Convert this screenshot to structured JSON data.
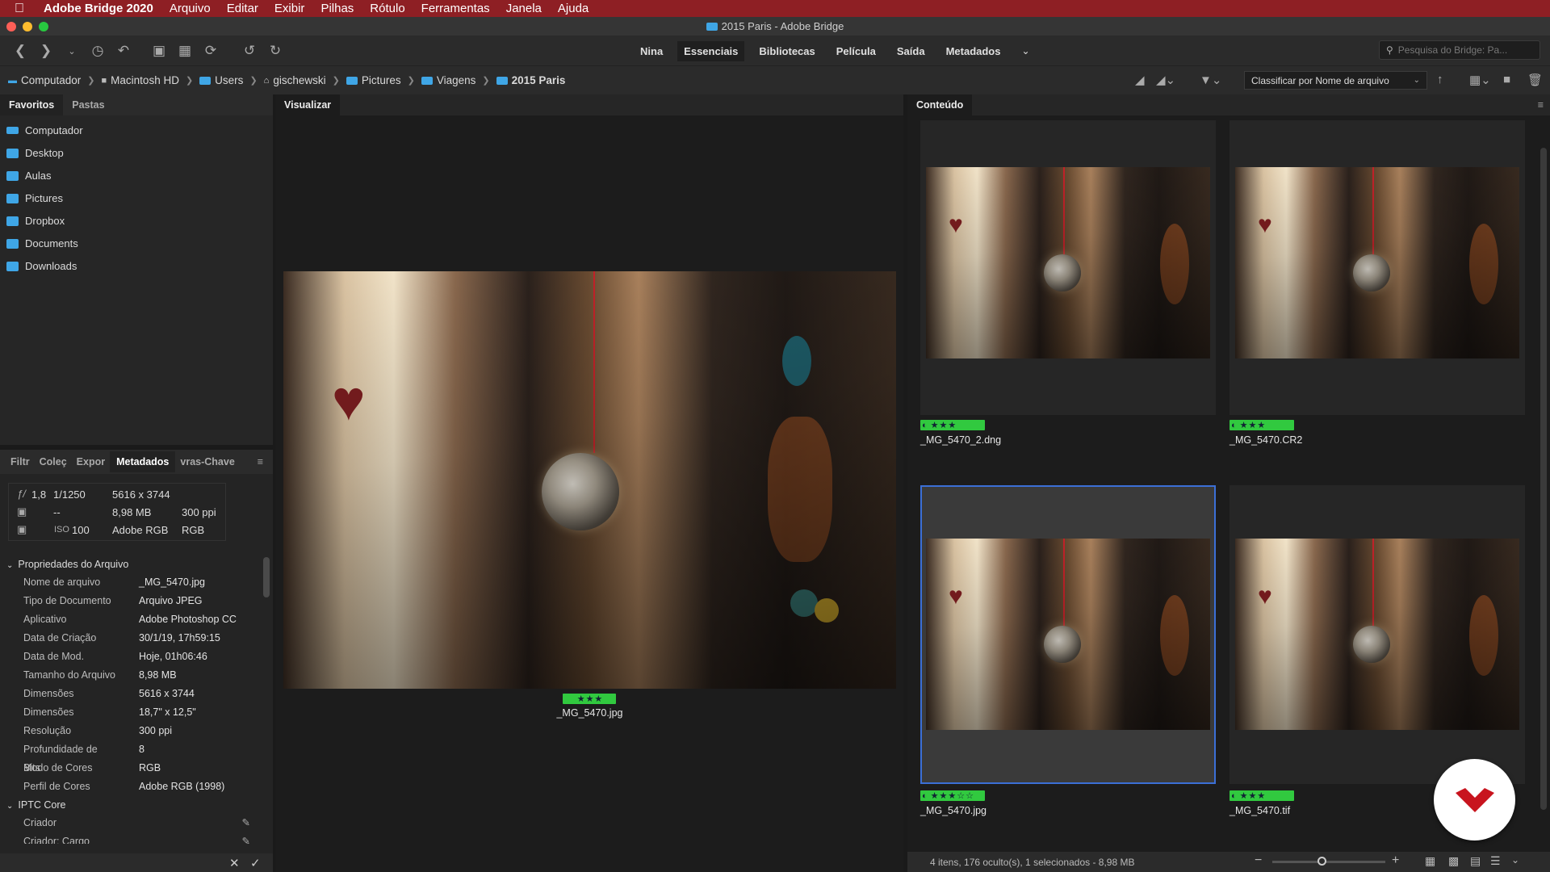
{
  "menubar": {
    "app_name": "Adobe Bridge 2020",
    "items": [
      "Arquivo",
      "Editar",
      "Exibir",
      "Pilhas",
      "Rótulo",
      "Ferramentas",
      "Janela",
      "Ajuda"
    ]
  },
  "window": {
    "title": "2015 Paris - Adobe Bridge"
  },
  "workspaces": [
    "Nina",
    "Essenciais",
    "Bibliotecas",
    "Película",
    "Saída",
    "Metadados"
  ],
  "active_workspace": "Essenciais",
  "search": {
    "placeholder": "Pesquisa do Bridge: Pa..."
  },
  "path": [
    "Computador",
    "Macintosh HD",
    "Users",
    "gischewski",
    "Pictures",
    "Viagens",
    "2015 Paris"
  ],
  "sort": {
    "label": "Classificar por Nome de arquivo"
  },
  "left_top": {
    "tabs": [
      "Favoritos",
      "Pastas"
    ],
    "favorites": [
      "Computador",
      "Desktop",
      "Aulas",
      "Pictures",
      "Dropbox",
      "Documents",
      "Downloads"
    ]
  },
  "left_bottom": {
    "tabs": [
      "Filtr",
      "Coleç",
      "Expor",
      "Metadados",
      "vras-Chave"
    ],
    "exif": {
      "aperture": "1,8",
      "shutter": "1/1250",
      "dimensions": "5616 x 3744",
      "metering": "--",
      "size": "8,98 MB",
      "resolution": "300 ppi",
      "iso_label": "ISO",
      "iso": "100",
      "profile": "Adobe RGB",
      "mode": "RGB"
    },
    "file_props_header": "Propriedades do Arquivo",
    "file_props": [
      {
        "k": "Nome de arquivo",
        "v": "_MG_5470.jpg"
      },
      {
        "k": "Tipo de Documento",
        "v": "Arquivo JPEG"
      },
      {
        "k": "Aplicativo",
        "v": "Adobe Photoshop CC"
      },
      {
        "k": "Data de Criação",
        "v": "30/1/19, 17h59:15"
      },
      {
        "k": "Data de Mod.",
        "v": "Hoje, 01h06:46"
      },
      {
        "k": "Tamanho do Arquivo",
        "v": "8,98 MB"
      },
      {
        "k": "Dimensões",
        "v": "5616 x 3744"
      },
      {
        "k": "Dimensões",
        "v": "18,7\" x 12,5\""
      },
      {
        "k": "Resolução",
        "v": "300 ppi"
      },
      {
        "k": "Profundidade de Bits",
        "v": "8"
      },
      {
        "k": "Modo de Cores",
        "v": "RGB"
      },
      {
        "k": "Perfil de Cores",
        "v": "Adobe RGB (1998)"
      }
    ],
    "iptc_header": "IPTC Core",
    "iptc": [
      "Criador",
      "Criador: Cargo"
    ]
  },
  "preview": {
    "tab": "Visualizar",
    "file": "_MG_5470.jpg",
    "rating": 3
  },
  "content": {
    "tab": "Conteúdo",
    "items": [
      {
        "name": "_MG_5470_2.dng",
        "rating": 3,
        "max": 3,
        "selected": false
      },
      {
        "name": "_MG_5470.CR2",
        "rating": 3,
        "max": 3,
        "selected": false
      },
      {
        "name": "_MG_5470.jpg",
        "rating": 3,
        "max": 5,
        "selected": true
      },
      {
        "name": "_MG_5470.tif",
        "rating": 3,
        "max": 3,
        "selected": false
      }
    ],
    "status": "4 itens, 176 oculto(s), 1 selecionados - 8,98 MB"
  },
  "colors": {
    "menubar": "#8e1f24",
    "label_green": "#31c93f",
    "selection": "#3b6fd6",
    "logo_red": "#c8141e"
  }
}
